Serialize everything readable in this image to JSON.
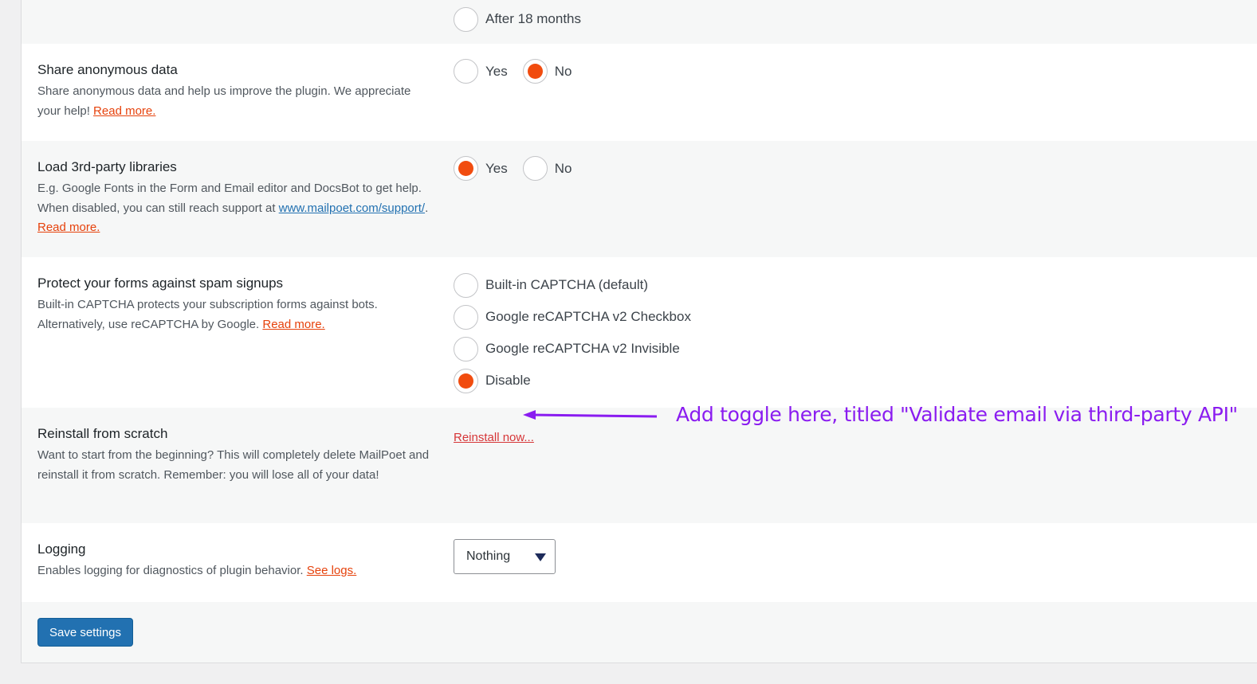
{
  "retention": {
    "option_label": "After 18 months"
  },
  "share_data": {
    "title": "Share anonymous data",
    "desc": "Share anonymous data and help us improve the plugin. We appreciate your help!",
    "link": "Read more.",
    "options": [
      "Yes",
      "No"
    ],
    "selected": "No"
  },
  "libraries": {
    "title": "Load 3rd-party libraries",
    "desc": "E.g. Google Fonts in the Form and Email editor and DocsBot to get help. When disabled, you can still reach support at",
    "support_link": "www.mailpoet.com/support/",
    "link": "Read more.",
    "options": [
      "Yes",
      "No"
    ],
    "selected": "Yes"
  },
  "captcha": {
    "title": "Protect your forms against spam signups",
    "desc": "Built-in CAPTCHA protects your subscription forms against bots. Alternatively, use reCAPTCHA by Google.",
    "link": "Read more.",
    "options": [
      "Built-in CAPTCHA (default)",
      "Google reCAPTCHA v2 Checkbox",
      "Google reCAPTCHA v2 Invisible",
      "Disable"
    ],
    "selected": "Disable"
  },
  "reinstall": {
    "title": "Reinstall from scratch",
    "desc": "Want to start from the beginning? This will completely delete MailPoet and reinstall it from scratch. Remember: you will lose all of your data!",
    "link": "Reinstall now..."
  },
  "logging": {
    "title": "Logging",
    "desc": "Enables logging for diagnostics of plugin behavior.",
    "link": "See logs.",
    "select_value": "Nothing"
  },
  "save_label": "Save settings",
  "annotation": {
    "text": "Add toggle here, titled \"Validate email via third-party API\"",
    "color": "#8a1cf0"
  },
  "colors": {
    "accent": "#f14c0f",
    "primary_button": "#2271b1",
    "danger_link": "#d63638"
  }
}
